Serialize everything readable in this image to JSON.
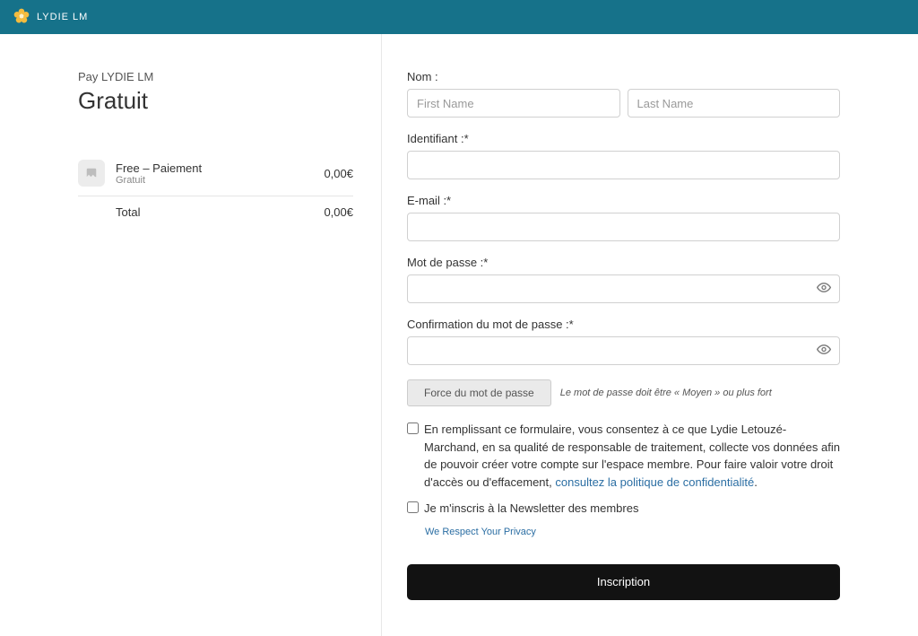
{
  "brand": {
    "name": "LYDIE LM"
  },
  "left": {
    "pay_label": "Pay LYDIE LM",
    "plan_title": "Gratuit",
    "item": {
      "name": "Free – Paiement",
      "sub": "Gratuit",
      "price": "0,00€"
    },
    "total": {
      "label": "Total",
      "price": "0,00€"
    }
  },
  "form": {
    "name_label": "Nom :",
    "first_name_placeholder": "First Name",
    "last_name_placeholder": "Last Name",
    "username_label": "Identifiant :*",
    "email_label": "E-mail :*",
    "password_label": "Mot de passe :*",
    "confirm_label": "Confirmation du mot de passe :*",
    "strength_indicator": "Force du mot de passe",
    "strength_note": "Le mot de passe doit être « Moyen » ou plus fort",
    "consent_text_a": "En remplissant ce formulaire, vous consentez à ce que Lydie Letouzé-Marchand, en sa qualité de responsable de traitement, collecte vos données afin de pouvoir créer votre compte sur l'espace membre. Pour faire valoir votre droit d'accès ou d'effacement, ",
    "consent_link": "consultez la politique de confidentialité",
    "consent_period": ".",
    "newsletter_label": "Je m'inscris à la Newsletter des membres",
    "privacy_text": "We Respect Your Privacy",
    "submit_label": "Inscription"
  }
}
